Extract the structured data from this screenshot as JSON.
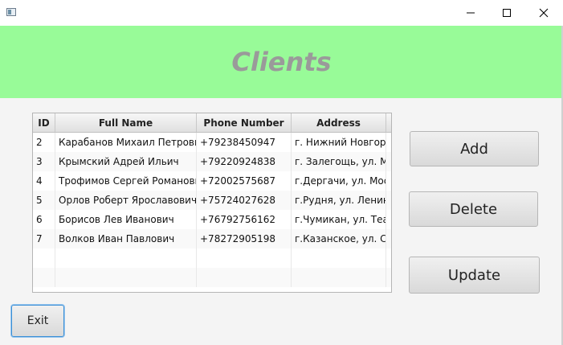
{
  "window": {
    "title": "",
    "controls": {
      "minimize_icon": "minimize-icon",
      "maximize_icon": "maximize-icon",
      "close_icon": "close-icon"
    }
  },
  "header": {
    "title": "Clients",
    "background": "#98fb98",
    "title_color": "#9a9a9a"
  },
  "table": {
    "columns": [
      "ID",
      "Full Name",
      "Phone Number",
      "Address"
    ],
    "rows": [
      {
        "id": "2",
        "name": "Карабанов Михаил Петрович",
        "phone": "+79238450947",
        "address": "г. Нижний Новгор..."
      },
      {
        "id": "3",
        "name": "Крымский Адрей Ильич",
        "phone": "+79220924838",
        "address": "г. Залегощь, ул. М..."
      },
      {
        "id": "4",
        "name": "Трофимов Сергей Романович",
        "phone": "+72002575687",
        "address": "г.Дергачи, ул. Мос..."
      },
      {
        "id": "5",
        "name": "Орлов Роберт Ярославович",
        "phone": "+75724027628",
        "address": "г.Рудня, ул. Ленин..."
      },
      {
        "id": "6",
        "name": "Борисов Лев Иванович",
        "phone": "+76792756162",
        "address": "г.Чумикан, ул. Теа..."
      },
      {
        "id": "7",
        "name": "Волков Иван Павлович",
        "phone": "+78272905198",
        "address": "г.Казанское, ул. Со..."
      }
    ]
  },
  "buttons": {
    "add": "Add",
    "delete": "Delete",
    "update": "Update",
    "exit": "Exit"
  }
}
